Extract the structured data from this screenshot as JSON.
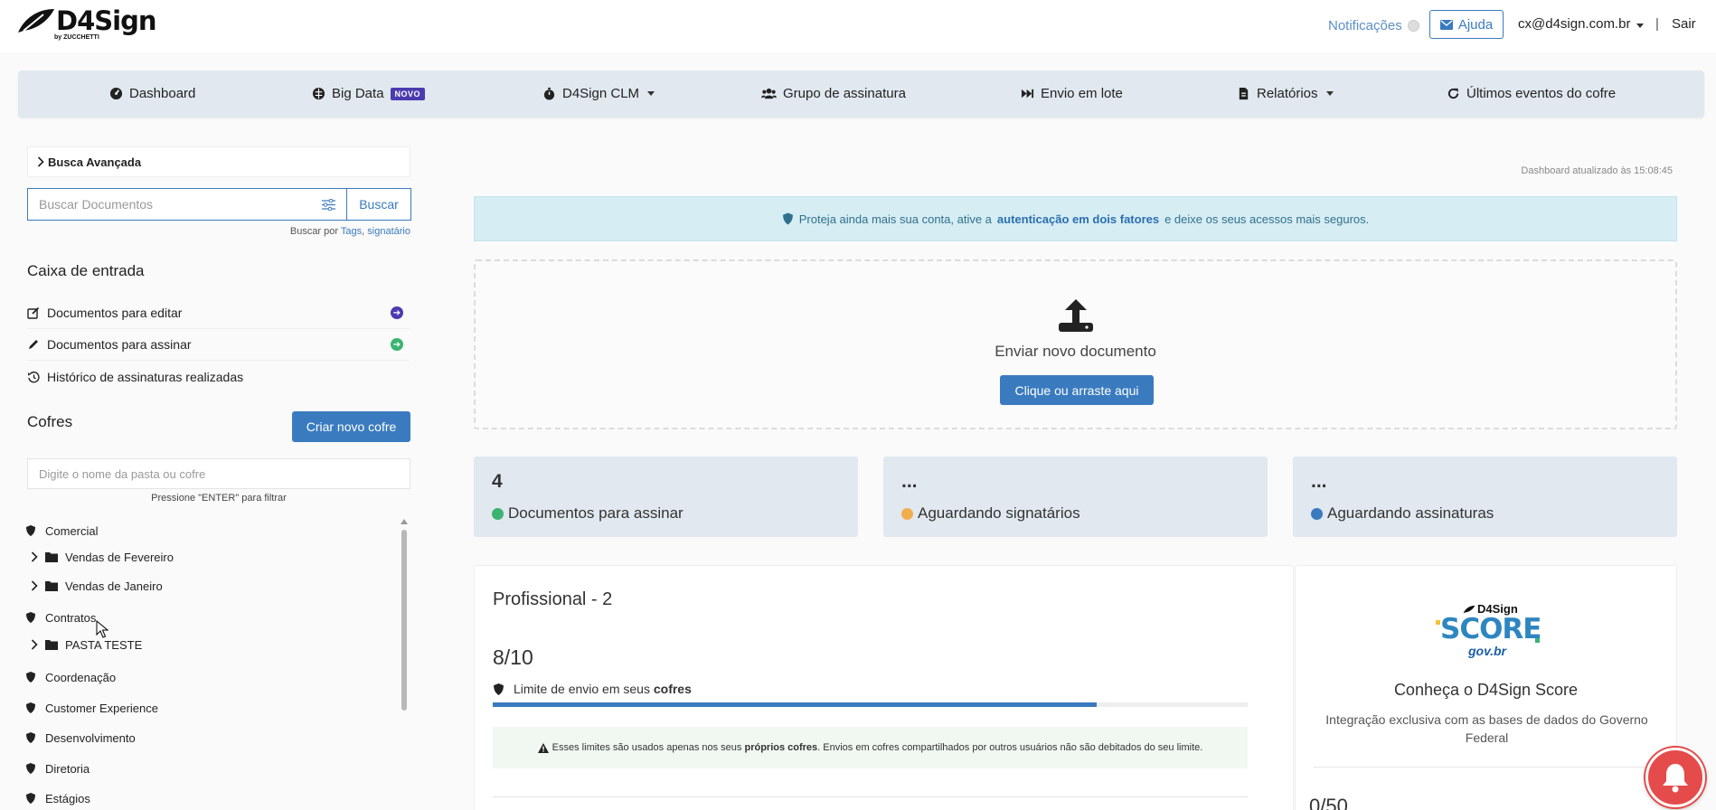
{
  "header": {
    "logo_text": "D4Sign",
    "logo_sub": "by ZUCCHETTI",
    "notifications_label": "Notificações",
    "help_label": "Ajuda",
    "user_email": "cx@d4sign.com.br",
    "separator": "|",
    "logout_label": "Sair"
  },
  "nav": {
    "items": [
      {
        "label": "Dashboard",
        "icon": "dashboard-icon"
      },
      {
        "label": "Big Data",
        "icon": "brain-icon",
        "badge": "NOVO"
      },
      {
        "label": "D4Sign CLM",
        "icon": "stopwatch-icon",
        "dropdown": true
      },
      {
        "label": "Grupo de assinatura",
        "icon": "users-icon"
      },
      {
        "label": "Envio em lote",
        "icon": "fast-forward-icon"
      },
      {
        "label": "Relatórios",
        "icon": "report-icon",
        "dropdown": true
      },
      {
        "label": "Últimos eventos do cofre",
        "icon": "refresh-icon"
      }
    ]
  },
  "sidebar": {
    "advanced_search_label": "Busca Avançada",
    "search_placeholder": "Buscar Documentos",
    "search_button": "Buscar",
    "search_hint_prefix": "Buscar por",
    "search_hint_tags": "Tags",
    "search_hint_comma": ",",
    "search_hint_signer": "signatário",
    "inbox_title": "Caixa de entrada",
    "inbox_items": [
      {
        "label": "Documentos para editar",
        "icon": "edit-icon",
        "arrow_color": "#4b3bb0"
      },
      {
        "label": "Documentos para assinar",
        "icon": "pencil-icon",
        "arrow_color": "#3cb371"
      },
      {
        "label": "Histórico de assinaturas realizadas",
        "icon": "history-icon"
      }
    ],
    "vaults_title": "Cofres",
    "new_vault_button": "Criar novo cofre",
    "filter_placeholder": "Digite o nome da pasta ou cofre",
    "filter_hint": "Pressione \"ENTER\" para filtrar",
    "vaults": [
      {
        "label": "Comercial",
        "type": "vault"
      },
      {
        "label": "Vendas de Fevereiro",
        "type": "folder"
      },
      {
        "label": "Vendas de Janeiro",
        "type": "folder"
      },
      {
        "label": "Contratos",
        "type": "vault"
      },
      {
        "label": "PASTA TESTE",
        "type": "folder"
      },
      {
        "label": "Coordenação",
        "type": "vault"
      },
      {
        "label": "Customer Experience",
        "type": "vault"
      },
      {
        "label": "Desenvolvimento",
        "type": "vault"
      },
      {
        "label": "Diretoria",
        "type": "vault"
      },
      {
        "label": "Estágios",
        "type": "vault"
      }
    ]
  },
  "main": {
    "updated_text": "Dashboard atualizado às 15:08:45",
    "alert": {
      "prefix": "Proteja ainda mais sua conta, ative a",
      "link": "autenticação em dois fatores",
      "suffix": "e deixe os seus acessos mais seguros."
    },
    "upload": {
      "label": "Enviar novo documento",
      "button": "Clique ou arraste aqui"
    },
    "stats": [
      {
        "value": "4",
        "label": "Documentos para assinar",
        "color": "#3cb371"
      },
      {
        "value": "...",
        "label": "Aguardando signatários",
        "color": "#f0ad4e"
      },
      {
        "value": "...",
        "label": "Aguardando assinaturas",
        "color": "#3a7bbf"
      }
    ],
    "plan": {
      "title": "Profissional - 2",
      "count": "8/10",
      "limit_prefix": "Limite de envio em seus",
      "limit_bold": "cofres",
      "progress_fraction": 0.8,
      "note_prefix": "Esses limites são usados apenas nos seus",
      "note_bold": "próprios cofres",
      "note_suffix": ". Envios em cofres compartilhados por outros usuários não são debitados do seu limite."
    },
    "score": {
      "logo_brand": "D4Sign",
      "logo_word": "SCORE",
      "logo_gov": "gov.br",
      "title": "Conheça o D4Sign Score",
      "description": "Integração exclusiva com as bases de dados do Governo Federal",
      "count": "0/50"
    }
  },
  "colors": {
    "primary": "#3a7bbf",
    "nav_bg": "#e1e8ef",
    "badge": "#4b3bb0",
    "alert_bg": "#d6edf3",
    "bell": "#e54b4b"
  }
}
